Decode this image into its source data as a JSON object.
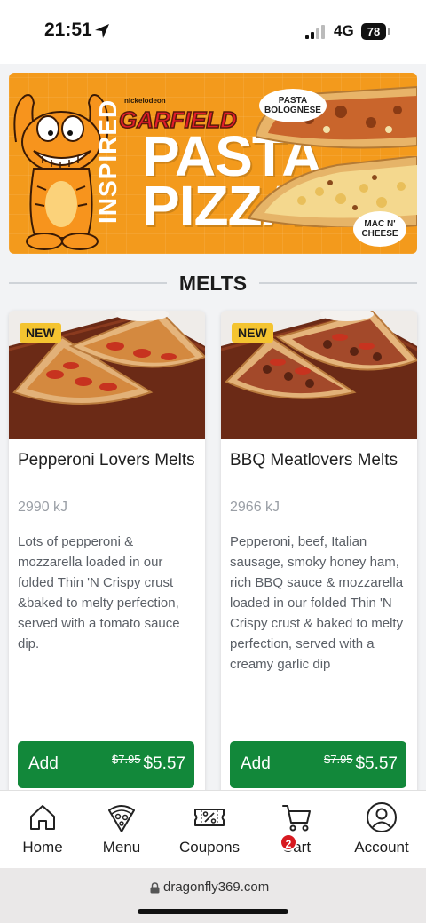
{
  "status_bar": {
    "time": "21:51",
    "network": "4G",
    "battery": "78",
    "icons": [
      "location-arrow-icon",
      "signal-icon",
      "battery-icon"
    ]
  },
  "banner": {
    "brand_small": "nickelodeon",
    "brand": "GARFIELD",
    "inspired": "INSPIRED",
    "line1": "PASTA",
    "line2": "PIZZAS",
    "badge_top": "PASTA BOLOGNESE",
    "badge_bottom": "MAC N' CHEESE"
  },
  "section": {
    "title": "MELTS"
  },
  "products": [
    {
      "badge": "NEW",
      "name": "Pepperoni Lovers Melts",
      "energy": "2990 kJ",
      "description": "Lots of pepperoni & mozzarella loaded in our folded Thin 'N Crispy crust &baked to melty perfection, served with a tomato sauce dip.",
      "add_label": "Add",
      "old_price": "$7.95",
      "price": "$5.57"
    },
    {
      "badge": "NEW",
      "name": "BBQ Meatlovers Melts",
      "energy": "2966 kJ",
      "description": "Pepperoni, beef, Italian sausage, smoky honey ham, rich BBQ sauce & mozzarella loaded in our folded Thin 'N Crispy crust & baked to melty perfection, served with a creamy garlic dip",
      "add_label": "Add",
      "old_price": "$7.95",
      "price": "$5.57"
    }
  ],
  "bottom_nav": {
    "items": [
      {
        "label": "Home",
        "icon": "home-icon"
      },
      {
        "label": "Menu",
        "icon": "pizza-slice-icon"
      },
      {
        "label": "Coupons",
        "icon": "coupon-icon"
      },
      {
        "label": "Cart",
        "icon": "cart-icon"
      },
      {
        "label": "Account",
        "icon": "account-icon"
      }
    ],
    "cart_count": "2"
  },
  "browser": {
    "url": "dragonfly369.com"
  },
  "colors": {
    "accent_green": "#12883a",
    "banner_orange": "#f39a1c",
    "badge_yellow": "#f4c430",
    "cart_badge_red": "#d71920"
  }
}
